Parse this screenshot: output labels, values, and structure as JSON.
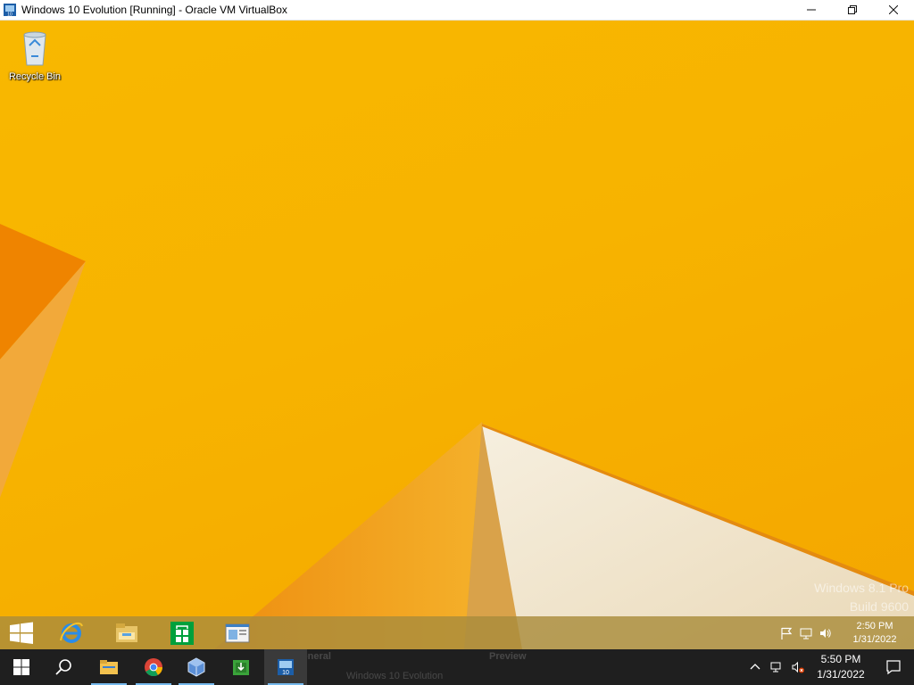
{
  "host_window": {
    "title": "Windows 10 Evolution [Running] - Oracle VM VirtualBox",
    "icons": {
      "app": "virtualbox-vm-icon",
      "minimize": "minimize-icon",
      "maximize": "maximize-icon",
      "close": "close-icon"
    }
  },
  "desktop": {
    "icons": [
      {
        "label": "Recycle Bin",
        "icon": "recycle-bin-icon"
      }
    ],
    "watermark": {
      "line1": "Windows 8.1 Pro",
      "line2": "Build 9600"
    },
    "colors": {
      "background": "#f7b300",
      "accent_orange": "#ee8a00",
      "light_shape": "#f4ecdc"
    }
  },
  "guest_taskbar": {
    "pinned": [
      {
        "icon": "start-icon"
      },
      {
        "icon": "internet-explorer-icon"
      },
      {
        "icon": "file-explorer-icon"
      },
      {
        "icon": "store-icon"
      },
      {
        "icon": "app-window-icon"
      }
    ],
    "tray_icons": [
      "flag-icon",
      "network-icon",
      "volume-icon"
    ],
    "time": "2:50 PM",
    "date": "1/31/2022"
  },
  "host_taskbar": {
    "buttons": [
      {
        "icon": "windows-start-icon"
      },
      {
        "icon": "search-icon"
      },
      {
        "icon": "file-explorer-icon"
      },
      {
        "icon": "chrome-icon"
      },
      {
        "icon": "virtualbox-icon"
      },
      {
        "icon": "installer-icon"
      },
      {
        "icon": "virtualbox-vm-icon"
      }
    ],
    "ghost_text": {
      "general": "General",
      "preview": "Preview",
      "vm_name": "Windows 10 Evolution"
    },
    "tray_icons": [
      "chevron-up-icon",
      "network-icon",
      "volume-muted-icon"
    ],
    "time": "5:50 PM",
    "date": "1/31/2022",
    "notification_icon": "notification-icon"
  }
}
